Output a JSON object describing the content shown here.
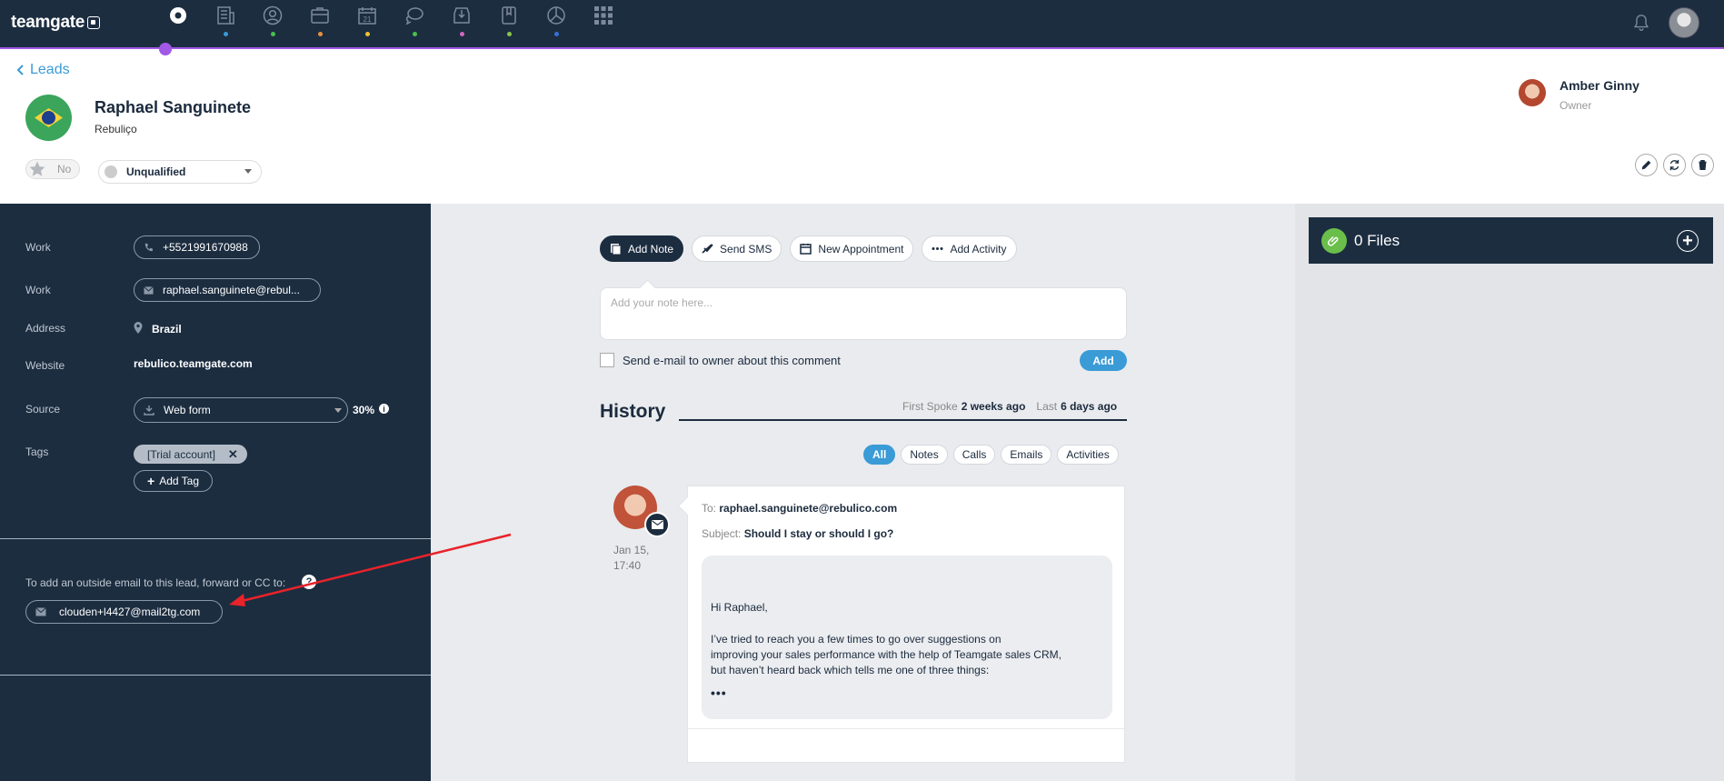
{
  "app": {
    "logo_text": "teamgate",
    "nav_icons": [
      {
        "icon": "dashboard-icon",
        "dot": ""
      },
      {
        "icon": "companies-icon",
        "dot": "#3a9bd6"
      },
      {
        "icon": "people-icon",
        "dot": "#47c04b"
      },
      {
        "icon": "deals-icon",
        "dot": "#e8913b"
      },
      {
        "icon": "calendar-icon",
        "dot": "#f2c12e"
      },
      {
        "icon": "chat-icon",
        "dot": "#47c04b"
      },
      {
        "icon": "inbox-icon",
        "dot": "#d266c1"
      },
      {
        "icon": "documents-icon",
        "dot": "#8bc34a"
      },
      {
        "icon": "reports-icon",
        "dot": "#3a6fd6"
      },
      {
        "icon": "apps-grid-icon",
        "dot": ""
      }
    ],
    "calendar_day": "21"
  },
  "header": {
    "back_label": "Leads",
    "lead_name": "Raphael Sanguinete",
    "company": "Rebuliço",
    "star_label": "No",
    "status": "Unqualified",
    "owner_name": "Amber Ginny",
    "owner_role": "Owner"
  },
  "details": {
    "phone_label": "Work",
    "phone": "+5521991670988",
    "email_label": "Work",
    "email": "raphael.sanguinete@rebul...",
    "address_label": "Address",
    "address": "Brazil",
    "website_label": "Website",
    "website": "rebulico.teamgate.com",
    "source_label": "Source",
    "source": "Web form",
    "source_pct": "30%",
    "tags_label": "Tags",
    "tag": "[Trial account]",
    "add_tag_label": "Add Tag",
    "forward_text": "To add an outside email to this lead, forward or CC to:",
    "forward_email": "clouden+l4427@mail2tg.com"
  },
  "composer": {
    "tabs": [
      "Add Note",
      "Send SMS",
      "New Appointment",
      "Add Activity"
    ],
    "note_placeholder": "Add your note here...",
    "checkbox_label": "Send e-mail to owner about this comment",
    "add_button": "Add"
  },
  "history": {
    "title": "History",
    "first_spoke_label": "First Spoke",
    "first_spoke_value": "2 weeks ago",
    "last_label": "Last",
    "last_value": "6 days ago",
    "filters": [
      "All",
      "Notes",
      "Calls",
      "Emails",
      "Activities"
    ],
    "entry": {
      "date_line1": "Jan 15,",
      "date_line2": "17:40",
      "to_label": "To:",
      "to_value": "raphael.sanguinete@rebulico.com",
      "subject_label": "Subject:",
      "subject_value": "Should I stay or should I go?",
      "greeting": "Hi Raphael,",
      "body_line1": "I’ve tried to reach you a few times to go over suggestions on",
      "body_line2": "improving your sales performance with the help of Teamgate sales CRM,",
      "body_line3": "but haven’t heard back which tells me one of three things:",
      "more": "•••"
    }
  },
  "files": {
    "label": "0 Files",
    "add_symbol": "+"
  },
  "colors": {
    "navy": "#1c2d40",
    "accent_blue": "#3a9bd6",
    "active_purple": "#a259e6",
    "files_green": "#6abf4b",
    "annotation_red": "#e8232a"
  }
}
